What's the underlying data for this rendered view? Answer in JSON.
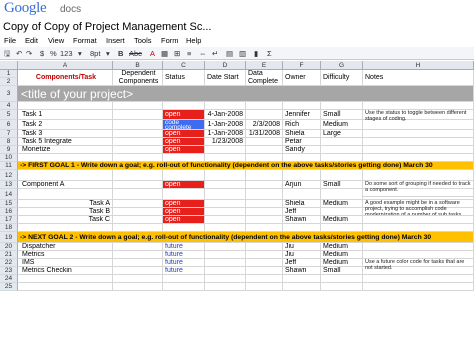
{
  "app": {
    "logo_google": "Google",
    "logo_docs": "docs",
    "title": "Copy of Copy of Project Management Sc..."
  },
  "menu": [
    "File",
    "Edit",
    "View",
    "Format",
    "Insert",
    "Tools",
    "Form",
    "Help"
  ],
  "toolbar": {
    "zoom": "123",
    "font_size": "8pt"
  },
  "columns": [
    "A",
    "B",
    "C",
    "D",
    "E",
    "F",
    "G",
    "H"
  ],
  "headers": {
    "task": "Components/Task",
    "dependent": "Dependent Components",
    "status": "Status",
    "date_start": "Date Start",
    "date_complete": "Data Complete",
    "owner": "Owner",
    "difficulty": "Difficulty",
    "notes": "Notes"
  },
  "project_title": "<title of your project>",
  "row_numbers": [
    "1",
    "2",
    "3",
    "4",
    "5",
    "6",
    "7",
    "8",
    "9",
    "10",
    "11",
    "12",
    "13",
    "14",
    "15",
    "16",
    "17",
    "18",
    "19",
    "20",
    "21",
    "22",
    "23",
    "24",
    "25"
  ],
  "rows": {
    "r5": {
      "task": "Task 1",
      "status": "open",
      "start": "4-Jan-2008",
      "owner": "Jennifer",
      "difficulty": "Small",
      "note": "Use the status to toggle between different stages of coding."
    },
    "r6": {
      "task": "Task 2",
      "status": "code complete",
      "start": "1-Jan-2008",
      "complete": "2/3/2008",
      "owner": "Rich",
      "difficulty": "Medium"
    },
    "r7": {
      "task": "Task 3",
      "status": "open",
      "start": "1-Jan-2008",
      "complete": "1/31/2008",
      "owner": "Shiela",
      "difficulty": "Large"
    },
    "r8": {
      "task": "Task 5 Integrate",
      "status": "open",
      "start": "1/23/2008",
      "owner": "Petar"
    },
    "r9": {
      "task": "Monetize",
      "status": "open",
      "owner": "Sandy"
    },
    "goal1": "-> FIRST GOAL 1 - Write down a goal; e.g. roll-out of functionality (dependent on the above tasks/stories getting done) March 30",
    "r13": {
      "task": "Component A",
      "status": "open",
      "owner": "Arjun",
      "difficulty": "Small",
      "note": "Do some sort of grouping if needed to track a component."
    },
    "r15": {
      "task": "Task A",
      "status": "open",
      "owner": "Shiela",
      "difficulty": "Medium",
      "note": "A good example might be in a software project, trying to accomplish code modernization of a number of sub tasks."
    },
    "r16": {
      "task": "Task B",
      "status": "open",
      "owner": "Jeff"
    },
    "r17": {
      "task": "Task C",
      "status": "open",
      "owner": "Shawn",
      "difficulty": "Medium"
    },
    "goal2": "-> NEXT GOAL 2 - Write down a goal; e.g. roll-out of functionality (dependent on the above tasks/stories getting done) March 30",
    "r20": {
      "task": "Dispatcher",
      "status": "future",
      "owner": "Jiu",
      "difficulty": "Medium"
    },
    "r21": {
      "task": "Metrics",
      "status": "future",
      "owner": "Jiu",
      "difficulty": "Medium"
    },
    "r22": {
      "task": "IMS",
      "status": "future",
      "owner": "Jeff",
      "difficulty": "Medium",
      "note": "Use a future color code for tasks that are not started."
    },
    "r23": {
      "task": "Metrics Checkin",
      "status": "future",
      "owner": "Shawn",
      "difficulty": "Small"
    }
  },
  "colors": {
    "red": "#e8201c",
    "blue": "#3d6cf0",
    "goal": "#ffc000",
    "title_bar": "#a6a6a6"
  }
}
